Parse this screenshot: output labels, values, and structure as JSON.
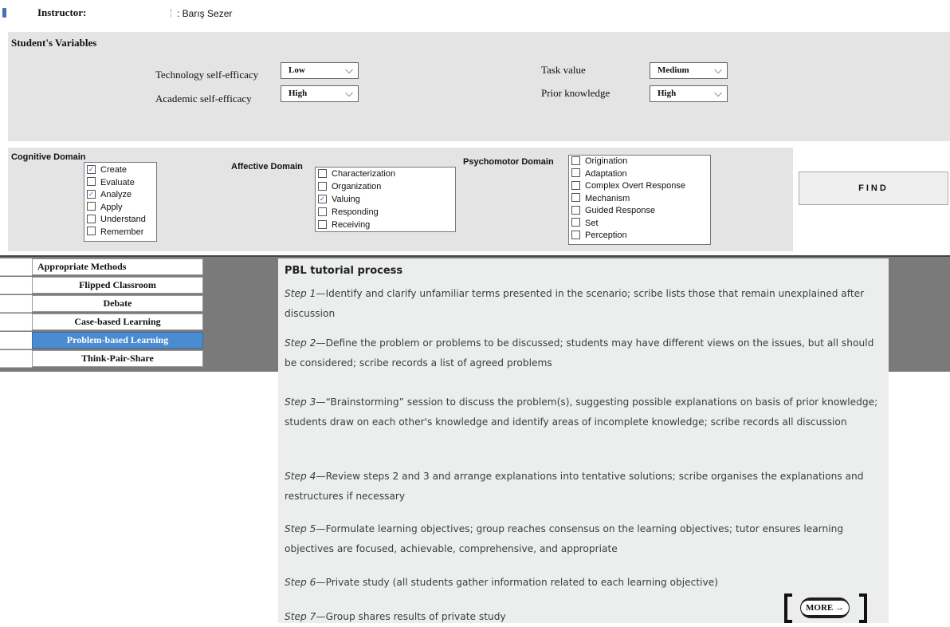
{
  "header": {
    "instructor_label": "Instructor:",
    "separator": "¦",
    "instructor_value": ": Barış Sezer"
  },
  "student_vars": {
    "title": "Student's Variables",
    "technology_self_efficacy": {
      "label": "Technology self-efficacy",
      "value": "Low"
    },
    "academic_self_efficacy": {
      "label": "Academic self-efficacy",
      "value": "High"
    },
    "task_value": {
      "label": "Task value",
      "value": "Medium"
    },
    "prior_knowledge": {
      "label": "Prior knowledge",
      "value": "High"
    }
  },
  "cognitive": {
    "title": "Cognitive Domain",
    "items": [
      {
        "label": "Create",
        "checked": true
      },
      {
        "label": "Evaluate",
        "checked": false
      },
      {
        "label": "Analyze",
        "checked": true
      },
      {
        "label": "Apply",
        "checked": false
      },
      {
        "label": "Understand",
        "checked": false
      },
      {
        "label": "Remember",
        "checked": false
      }
    ]
  },
  "affective": {
    "title": "Affective Domain",
    "items": [
      {
        "label": "Characterization",
        "checked": false
      },
      {
        "label": "Organization",
        "checked": false
      },
      {
        "label": "Valuing",
        "checked": true
      },
      {
        "label": "Responding",
        "checked": false
      },
      {
        "label": "Receiving",
        "checked": false
      }
    ]
  },
  "psychomotor": {
    "title": "Psychomotor Domain",
    "items": [
      {
        "label": "Origination",
        "checked": false
      },
      {
        "label": "Adaptation",
        "checked": false
      },
      {
        "label": "Complex Overt Response",
        "checked": false
      },
      {
        "label": "Mechanism",
        "checked": false
      },
      {
        "label": "Guided Response",
        "checked": false
      },
      {
        "label": "Set",
        "checked": false
      },
      {
        "label": "Perception",
        "checked": false
      }
    ]
  },
  "find_label": "FIND",
  "methods": {
    "header": "Appropriate Methods",
    "rows": [
      {
        "label": "Flipped Classroom",
        "selected": false
      },
      {
        "label": "Debate",
        "selected": false
      },
      {
        "label": "Case-based Learning",
        "selected": false
      },
      {
        "label": "Problem-based Learning",
        "selected": true
      },
      {
        "label": "Think-Pair-Share",
        "selected": false
      }
    ]
  },
  "pbl": {
    "title": "PBL tutorial process",
    "steps": [
      {
        "label": "Step 1",
        "text": "—Identify and clarify unfamiliar terms presented in the scenario; scribe lists those that remain unexplained after discussion"
      },
      {
        "label": "Step 2",
        "text": "—Define the problem or problems to be discussed; students may have different views on the issues, but all should be considered; scribe records a list of agreed problems"
      },
      {
        "label": "Step 3",
        "text": "—“Brainstorming” session to discuss the problem(s), suggesting possible explanations on basis of prior knowledge; students draw on each other's knowledge and identify areas of incomplete knowledge; scribe records all discussion"
      },
      {
        "label": "Step 4",
        "text": "—Review steps 2 and 3 and arrange explanations into tentative solutions; scribe organises the explanations and restructures if necessary"
      },
      {
        "label": "Step 5",
        "text": "—Formulate learning objectives; group reaches consensus on the learning objectives; tutor ensures learning objectives are focused, achievable, comprehensive, and appropriate"
      },
      {
        "label": "Step 6",
        "text": "—Private study (all students gather information related to each learning objective)"
      },
      {
        "label": "Step 7",
        "text": "—Group shares results of private study"
      }
    ]
  },
  "more_label": "MORE →"
}
